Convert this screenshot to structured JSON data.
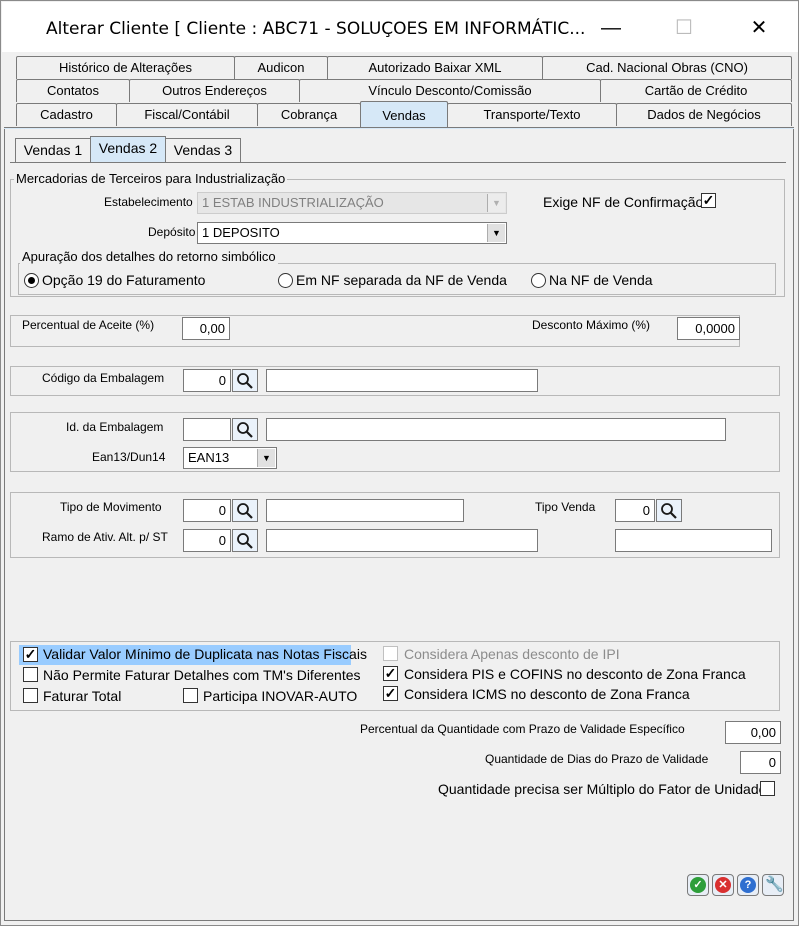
{
  "window": {
    "title": "Alterar Cliente [ Cliente : ABC71 - SOLUÇOES EM INFORMÁTIC...",
    "minimize": "—",
    "maximize": "☐",
    "close": "✕"
  },
  "tabs": {
    "row1": [
      "Histórico de Alterações",
      "Audicon",
      "Autorizado Baixar XML",
      "Cad. Nacional Obras (CNO)"
    ],
    "row2": [
      "Contatos",
      "Outros Endereços",
      "Vínculo Desconto/Comissão",
      "Cartão de Crédito"
    ],
    "row3": [
      "Cadastro",
      "Fiscal/Contábil",
      "Cobrança",
      "Vendas",
      "Transporte/Texto",
      "Dados de Negócios"
    ],
    "active": "Vendas"
  },
  "subtabs": [
    "Vendas 1",
    "Vendas 2",
    "Vendas 3"
  ],
  "subtab_active": "Vendas 2",
  "mercadorias": {
    "group_title": "Mercadorias de Terceiros para Industrialização",
    "estabelecimento_label": "Estabelecimento",
    "estabelecimento_value": "1 ESTAB INDUSTRIALIZAÇÃO",
    "deposito_label": "Depósito",
    "deposito_value": "1 DEPOSITO",
    "exige_nf_label": "Exige NF de Confirmação",
    "exige_nf_checked": true,
    "apuracao_title": "Apuração dos detalhes do retorno simbólico",
    "options": [
      "Opção 19 do Faturamento",
      "Em NF separada da NF de Venda",
      "Na NF de Venda"
    ],
    "selected_option": 0
  },
  "percentual": {
    "aceite_label": "Percentual de Aceite (%)",
    "aceite_value": "0,00",
    "desconto_label": "Desconto Máximo (%)",
    "desconto_value": "0,0000"
  },
  "codigo_embalagem": {
    "label": "Código da Embalagem",
    "value": "0",
    "description": ""
  },
  "id_embalagem": {
    "label": "Id. da Embalagem",
    "value": "",
    "description": "",
    "ean_label": "Ean13/Dun14",
    "ean_value": "EAN13"
  },
  "movimento": {
    "tipo_mov_label": "Tipo de Movimento",
    "tipo_mov_value": "0",
    "tipo_mov_desc": "",
    "tipo_venda_label": "Tipo Venda",
    "tipo_venda_value": "0",
    "tipo_venda_desc": "",
    "ramo_label": "Ramo de Ativ. Alt. p/ ST",
    "ramo_value": "0",
    "ramo_desc": ""
  },
  "checks": {
    "validar_minimo": "Validar Valor Mínimo de Duplicata nas Notas Fiscais",
    "nao_permite": "Não Permite Faturar Detalhes com TM's Diferentes",
    "faturar_total": "Faturar Total",
    "participa_inovar": "Participa INOVAR-AUTO",
    "considera_ipi": "Considera Apenas desconto de IPI",
    "considera_pis": "Considera PIS e COFINS no desconto de Zona Franca",
    "considera_icms": "Considera ICMS no desconto de Zona Franca"
  },
  "validade": {
    "percentual_label": "Percentual da Quantidade com Prazo de Validade Específico",
    "percentual_value": "0,00",
    "dias_label": "Quantidade de Dias do Prazo de Validade",
    "dias_value": "0",
    "multiplo_label": "Quantidade precisa ser Múltiplo do Fator de Unidade"
  },
  "colors": {
    "active_tab": "#d6e8f7",
    "highlight": "#99ccff",
    "ok": "#2e9e3a",
    "cancel": "#d93030",
    "help": "#2f6fd0",
    "tool": "#e07a10"
  }
}
